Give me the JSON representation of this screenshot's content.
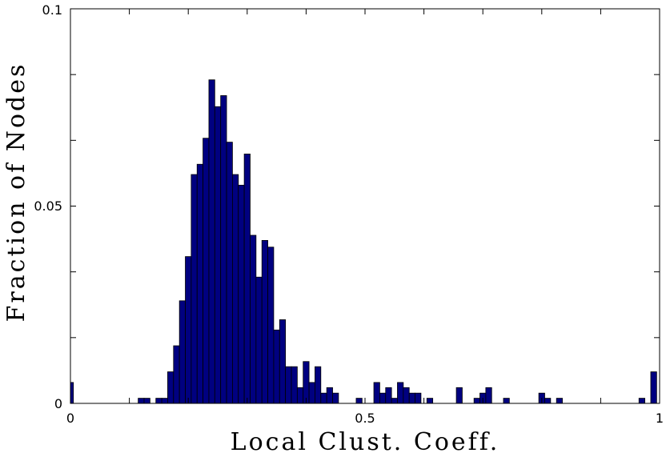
{
  "chart_data": {
    "type": "bar",
    "title": "",
    "xlabel": "Local Clust. Coeff.",
    "ylabel": "Fraction of Nodes",
    "xlim": [
      0,
      1
    ],
    "ylim": [
      0,
      0.1
    ],
    "x_ticks": [
      0,
      0.5,
      1
    ],
    "x_tick_labels": [
      "0",
      "0.5",
      "1"
    ],
    "y_ticks": [
      0,
      0.05,
      0.1
    ],
    "y_tick_labels": [
      "0",
      "0.05",
      "0.1"
    ],
    "grid": false,
    "bar_width": 0.01,
    "bar_color": "#000080",
    "x": [
      0.0,
      0.12,
      0.13,
      0.15,
      0.16,
      0.17,
      0.18,
      0.19,
      0.2,
      0.21,
      0.22,
      0.23,
      0.24,
      0.25,
      0.26,
      0.27,
      0.28,
      0.29,
      0.3,
      0.31,
      0.32,
      0.33,
      0.34,
      0.35,
      0.36,
      0.37,
      0.38,
      0.39,
      0.4,
      0.41,
      0.42,
      0.43,
      0.44,
      0.45,
      0.49,
      0.52,
      0.53,
      0.54,
      0.55,
      0.56,
      0.57,
      0.58,
      0.59,
      0.61,
      0.66,
      0.69,
      0.7,
      0.71,
      0.74,
      0.8,
      0.81,
      0.83,
      0.97,
      0.99
    ],
    "values": [
      0.0053,
      0.0013,
      0.0013,
      0.0013,
      0.0013,
      0.008,
      0.0146,
      0.026,
      0.0372,
      0.058,
      0.0606,
      0.0672,
      0.082,
      0.0752,
      0.078,
      0.0662,
      0.058,
      0.0553,
      0.0632,
      0.0426,
      0.032,
      0.0413,
      0.0396,
      0.0186,
      0.0212,
      0.0093,
      0.0093,
      0.004,
      0.0106,
      0.0053,
      0.0093,
      0.0026,
      0.004,
      0.0026,
      0.0013,
      0.0053,
      0.0026,
      0.004,
      0.0013,
      0.0053,
      0.004,
      0.0026,
      0.0026,
      0.0013,
      0.004,
      0.0013,
      0.0026,
      0.004,
      0.0013,
      0.0026,
      0.0013,
      0.0013,
      0.0013,
      0.008
    ]
  }
}
